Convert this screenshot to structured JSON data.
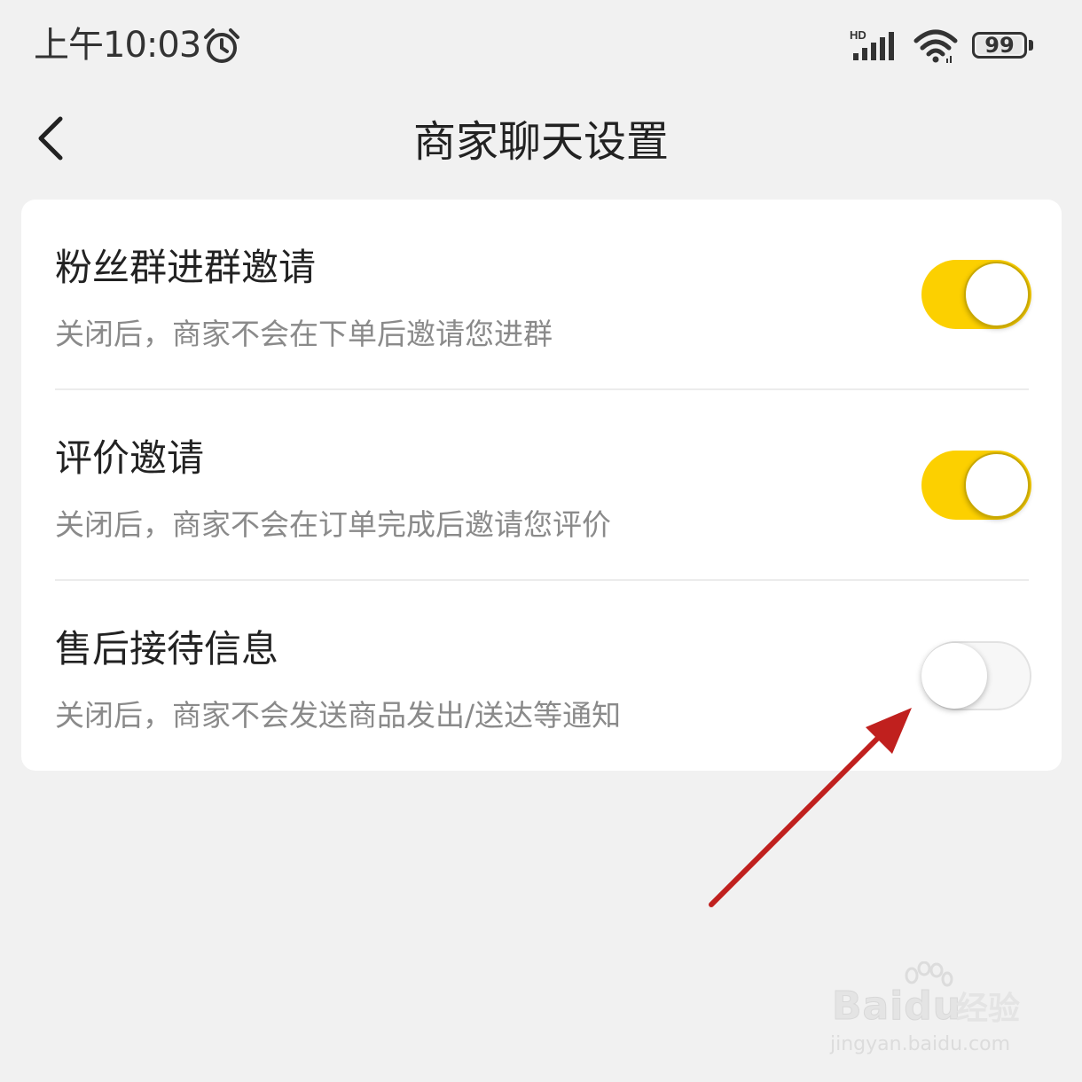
{
  "status_bar": {
    "time": "上午10:03",
    "network_label": "HD",
    "battery": "99",
    "battery_level": 0.99,
    "icons": [
      "alarm-icon",
      "signal-icon",
      "wifi-icon",
      "battery-icon"
    ]
  },
  "header": {
    "title": "商家聊天设置",
    "back_icon": "chevron-left-icon"
  },
  "settings": [
    {
      "title": "粉丝群进群邀请",
      "description": "关闭后，商家不会在下单后邀请您进群",
      "enabled": true
    },
    {
      "title": "评价邀请",
      "description": "关闭后，商家不会在订单完成后邀请您评价",
      "enabled": true
    },
    {
      "title": "售后接待信息",
      "description": "关闭后，商家不会发送商品发出/送达等通知",
      "enabled": false
    }
  ],
  "colors": {
    "toggle_on": "#fcd000",
    "toggle_off": "#f7f7f7",
    "background": "#f1f1f1",
    "annotation_arrow": "#c0201e"
  },
  "watermark": {
    "brand": "Baidu",
    "product": "经验",
    "url": "jingyan.baidu.com"
  }
}
